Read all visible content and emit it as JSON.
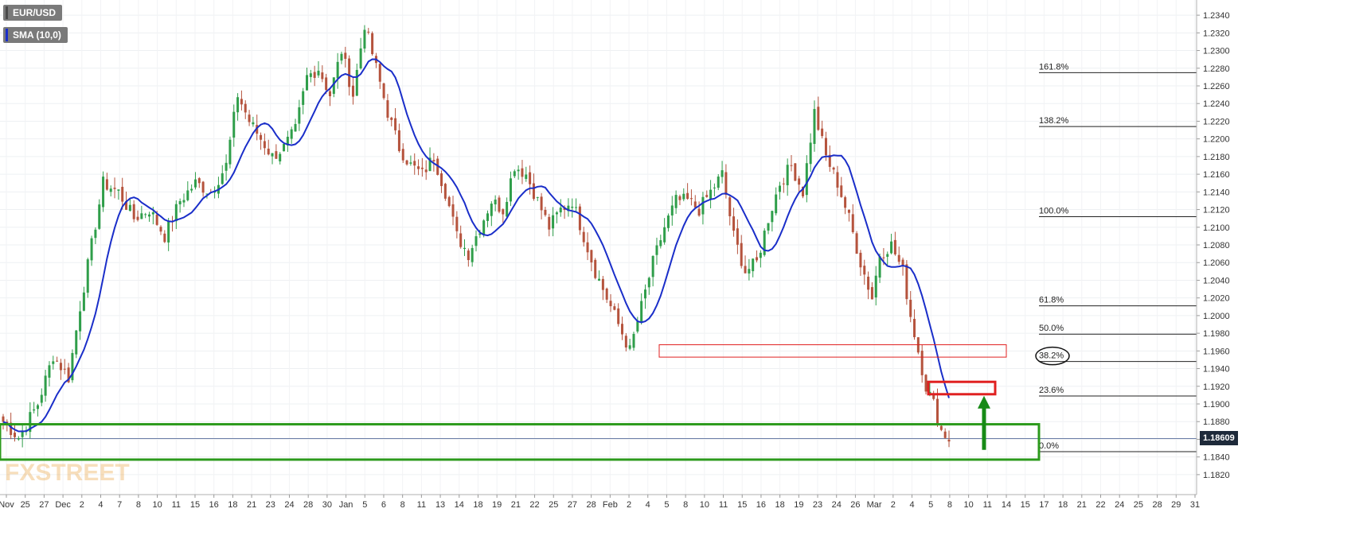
{
  "legend": {
    "pair": "EUR/USD",
    "indicator": "SMA (10,0)"
  },
  "watermark": "FXSTREET",
  "current_price": {
    "label": "1.18609",
    "value": 1.18609
  },
  "colors": {
    "bull": "#2f9e4a",
    "bear": "#b5533d",
    "sma": "#1a2ec9",
    "green_zone": "#2c9a1c",
    "red_zone": "#e02020",
    "arrow": "#168a16"
  },
  "chart_data": {
    "type": "candlestick",
    "symbol": "EUR/USD",
    "ylim": [
      1.181,
      1.235
    ],
    "y_ticks": [
      1.182,
      1.184,
      1.186,
      1.188,
      1.19,
      1.192,
      1.194,
      1.196,
      1.198,
      1.2,
      1.202,
      1.204,
      1.206,
      1.208,
      1.21,
      1.212,
      1.214,
      1.216,
      1.218,
      1.22,
      1.222,
      1.224,
      1.226,
      1.228,
      1.23,
      1.232,
      1.234
    ],
    "x_tick_labels": [
      "Nov",
      "25",
      "27",
      "Dec",
      "2",
      "4",
      "7",
      "8",
      "10",
      "11",
      "15",
      "16",
      "18",
      "21",
      "23",
      "24",
      "28",
      "30",
      "Jan",
      "5",
      "6",
      "8",
      "11",
      "13",
      "14",
      "18",
      "19",
      "21",
      "22",
      "25",
      "27",
      "28",
      "Feb",
      "2",
      "4",
      "5",
      "8",
      "10",
      "11",
      "15",
      "16",
      "18",
      "19",
      "23",
      "24",
      "26",
      "Mar",
      "2",
      "4",
      "5",
      "8",
      "10",
      "11",
      "14",
      "15",
      "17",
      "18",
      "21",
      "22",
      "24",
      "25",
      "28",
      "29",
      "31"
    ],
    "close_path": [
      [
        0,
        1.188
      ],
      [
        4,
        1.1862
      ],
      [
        9,
        1.19
      ],
      [
        13,
        1.1955
      ],
      [
        17,
        1.193
      ],
      [
        20,
        1.201
      ],
      [
        23,
        1.208
      ],
      [
        26,
        1.215
      ],
      [
        30,
        1.214
      ],
      [
        34,
        1.211
      ],
      [
        38,
        1.212
      ],
      [
        42,
        1.209
      ],
      [
        46,
        1.213
      ],
      [
        50,
        1.215
      ],
      [
        54,
        1.214
      ],
      [
        58,
        1.217
      ],
      [
        61,
        1.225
      ],
      [
        64,
        1.222
      ],
      [
        67,
        1.22
      ],
      [
        70,
        1.218
      ],
      [
        73,
        1.219
      ],
      [
        76,
        1.221
      ],
      [
        79,
        1.227
      ],
      [
        82,
        1.228
      ],
      [
        85,
        1.225
      ],
      [
        88,
        1.23
      ],
      [
        91,
        1.225
      ],
      [
        94,
        1.233
      ],
      [
        97,
        1.228
      ],
      [
        100,
        1.223
      ],
      [
        103,
        1.219
      ],
      [
        106,
        1.217
      ],
      [
        109,
        1.216
      ],
      [
        112,
        1.218
      ],
      [
        115,
        1.214
      ],
      [
        118,
        1.209
      ],
      [
        121,
        1.207
      ],
      [
        124,
        1.21
      ],
      [
        127,
        1.213
      ],
      [
        130,
        1.212
      ],
      [
        133,
        1.217
      ],
      [
        136,
        1.216
      ],
      [
        139,
        1.213
      ],
      [
        142,
        1.21
      ],
      [
        145,
        1.212
      ],
      [
        148,
        1.213
      ],
      [
        151,
        1.209
      ],
      [
        154,
        1.205
      ],
      [
        157,
        1.202
      ],
      [
        160,
        1.199
      ],
      [
        163,
        1.196
      ],
      [
        166,
        1.201
      ],
      [
        169,
        1.206
      ],
      [
        172,
        1.21
      ],
      [
        175,
        1.213
      ],
      [
        178,
        1.213
      ],
      [
        181,
        1.212
      ],
      [
        184,
        1.214
      ],
      [
        187,
        1.216
      ],
      [
        190,
        1.209
      ],
      [
        193,
        1.205
      ],
      [
        196,
        1.206
      ],
      [
        199,
        1.211
      ],
      [
        202,
        1.215
      ],
      [
        205,
        1.217
      ],
      [
        208,
        1.214
      ],
      [
        211,
        1.223
      ],
      [
        214,
        1.218
      ],
      [
        217,
        1.215
      ],
      [
        220,
        1.211
      ],
      [
        223,
        1.206
      ],
      [
        226,
        1.202
      ],
      [
        228,
        1.207
      ],
      [
        231,
        1.208
      ],
      [
        234,
        1.205
      ],
      [
        236,
        1.2
      ],
      [
        238,
        1.196
      ],
      [
        240,
        1.192
      ],
      [
        242,
        1.19
      ],
      [
        244,
        1.187
      ],
      [
        246,
        1.186
      ]
    ],
    "sma_period": 10,
    "fibonacci": [
      {
        "label": "161.8%",
        "value": 1.2275
      },
      {
        "label": "138.2%",
        "value": 1.2214
      },
      {
        "label": "100.0%",
        "value": 1.2112
      },
      {
        "label": "61.8%",
        "value": 1.2011
      },
      {
        "label": "50.0%",
        "value": 1.1979
      },
      {
        "label": "38.2%",
        "value": 1.1948
      },
      {
        "label": "23.6%",
        "value": 1.1909
      },
      {
        "label": "0.0%",
        "value": 1.1846
      }
    ],
    "zones": [
      {
        "kind": "support",
        "y_top": 1.1877,
        "y_bottom": 1.1837
      },
      {
        "kind": "resistance",
        "y_top": 1.1967,
        "y_bottom": 1.1953
      },
      {
        "kind": "target",
        "y_top": 1.1925,
        "y_bottom": 1.1911
      }
    ]
  }
}
